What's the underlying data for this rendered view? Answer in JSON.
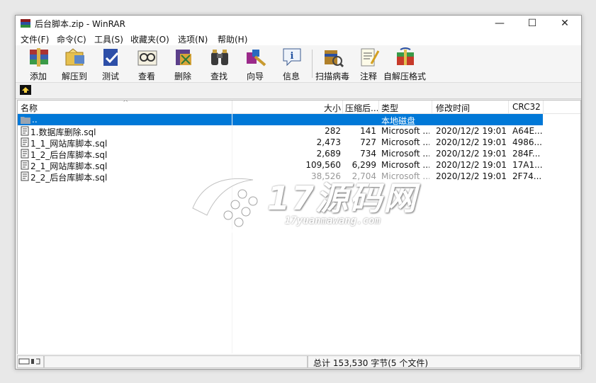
{
  "window": {
    "title": "后台脚本.zip - WinRAR",
    "minimize": "—",
    "maximize": "☐",
    "close": "✕"
  },
  "menu": [
    "文件(F)",
    "命令(C)",
    "工具(S)",
    "收藏夹(O)",
    "选项(N)",
    "帮助(H)"
  ],
  "toolbar": [
    {
      "label": "添加",
      "icon": "add-archive-icon"
    },
    {
      "label": "解压到",
      "icon": "extract-to-icon"
    },
    {
      "label": "测试",
      "icon": "test-icon"
    },
    {
      "label": "查看",
      "icon": "view-icon"
    },
    {
      "label": "删除",
      "icon": "delete-icon"
    },
    {
      "label": "查找",
      "icon": "find-icon"
    },
    {
      "label": "向导",
      "icon": "wizard-icon"
    },
    {
      "label": "信息",
      "icon": "info-icon"
    },
    {
      "label": "扫描病毒",
      "icon": "scan-virus-icon"
    },
    {
      "label": "注释",
      "icon": "comment-icon"
    },
    {
      "label": "自解压格式",
      "icon": "sfx-icon"
    }
  ],
  "columns": {
    "name": "名称",
    "size": "大小",
    "packed": "压缩后...",
    "type": "类型",
    "modified": "修改时间",
    "crc": "CRC32"
  },
  "rows": [
    {
      "name": "..",
      "size": "",
      "packed": "",
      "type": "本地磁盘",
      "modified": "",
      "crc": "",
      "selected": true
    },
    {
      "name": "1.数据库删除.sql",
      "size": "282",
      "packed": "141",
      "type": "Microsoft ...",
      "modified": "2020/12/2 19:01",
      "crc": "A64E..."
    },
    {
      "name": "1_1_网站库脚本.sql",
      "size": "2,473",
      "packed": "727",
      "type": "Microsoft ...",
      "modified": "2020/12/2 19:01",
      "crc": "4986..."
    },
    {
      "name": "1_2_后台库脚本.sql",
      "size": "2,689",
      "packed": "734",
      "type": "Microsoft ...",
      "modified": "2020/12/2 19:01",
      "crc": "284F..."
    },
    {
      "name": "2_1_网站库脚本.sql",
      "size": "109,560",
      "packed": "6,299",
      "type": "Microsoft ...",
      "modified": "2020/12/2 19:01",
      "crc": "17A1..."
    },
    {
      "name": "2_2_后台库脚本.sql",
      "size": "38,526",
      "packed": "2,704",
      "type": "Microsoft ...",
      "modified": "2020/12/2 19:01",
      "crc": "2F74..."
    }
  ],
  "status": {
    "text": "总计 153,530 字节(5 个文件)"
  },
  "watermark": {
    "main": "17源码网",
    "sub": "17yuanmawang.com"
  }
}
